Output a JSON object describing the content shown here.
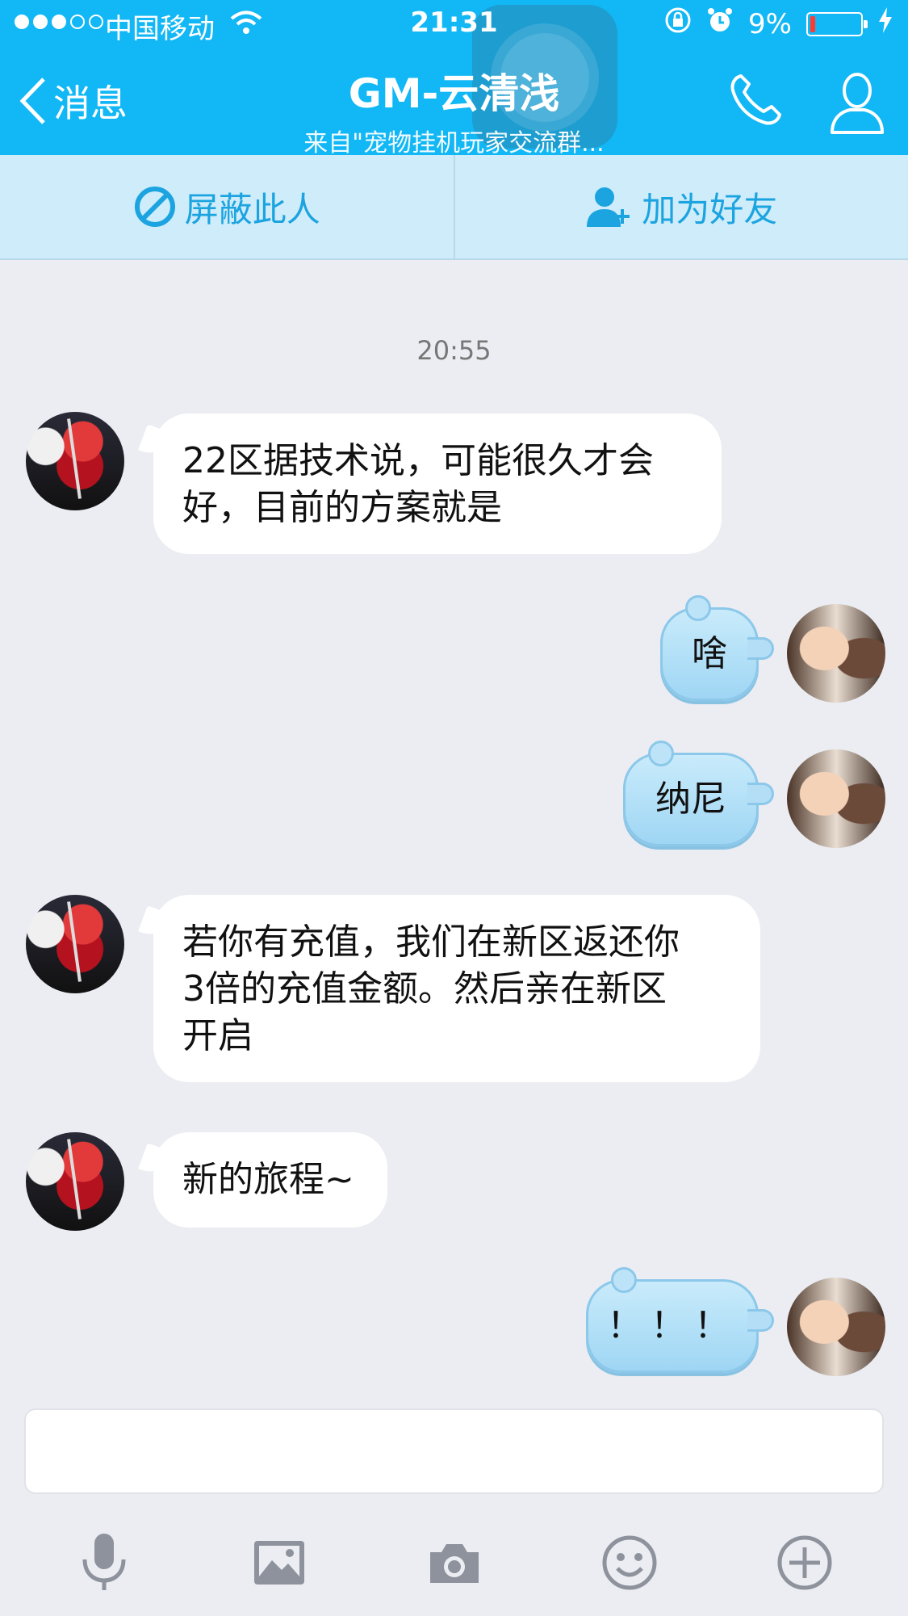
{
  "status_bar": {
    "carrier": "中国移动",
    "time": "21:31",
    "battery": "9%",
    "battery_level": 0.09
  },
  "nav": {
    "back_label": "消息",
    "title": "GM-云清浅",
    "subtitle": "来自\"宠物挂机玩家交流群..."
  },
  "actions": {
    "block_label": "屏蔽此人",
    "add_friend_label": "加为好友"
  },
  "chat": {
    "timestamp": "20:55",
    "messages": [
      {
        "from": "other",
        "lines": [
          "22区据技术说，可能很久才会",
          "好，目前的方案就是"
        ]
      },
      {
        "from": "me",
        "text": "啥"
      },
      {
        "from": "me",
        "text": "纳尼"
      },
      {
        "from": "other",
        "lines": [
          "若你有充值，我们在新区返还你",
          "3倍的充值金额。然后亲在新区",
          "开启"
        ]
      },
      {
        "from": "other",
        "lines": [
          "新的旅程~"
        ]
      },
      {
        "from": "me",
        "text": "！！！"
      }
    ]
  },
  "input": {
    "value": ""
  },
  "toolbar": {
    "icons": [
      "microphone-icon",
      "image-icon",
      "camera-icon",
      "emoji-icon",
      "plus-icon"
    ]
  },
  "colors": {
    "header": "#12b7f5",
    "action_bar": "#cfecfa",
    "action_text": "#1ba4e0",
    "chat_bg": "#ebedf2"
  }
}
